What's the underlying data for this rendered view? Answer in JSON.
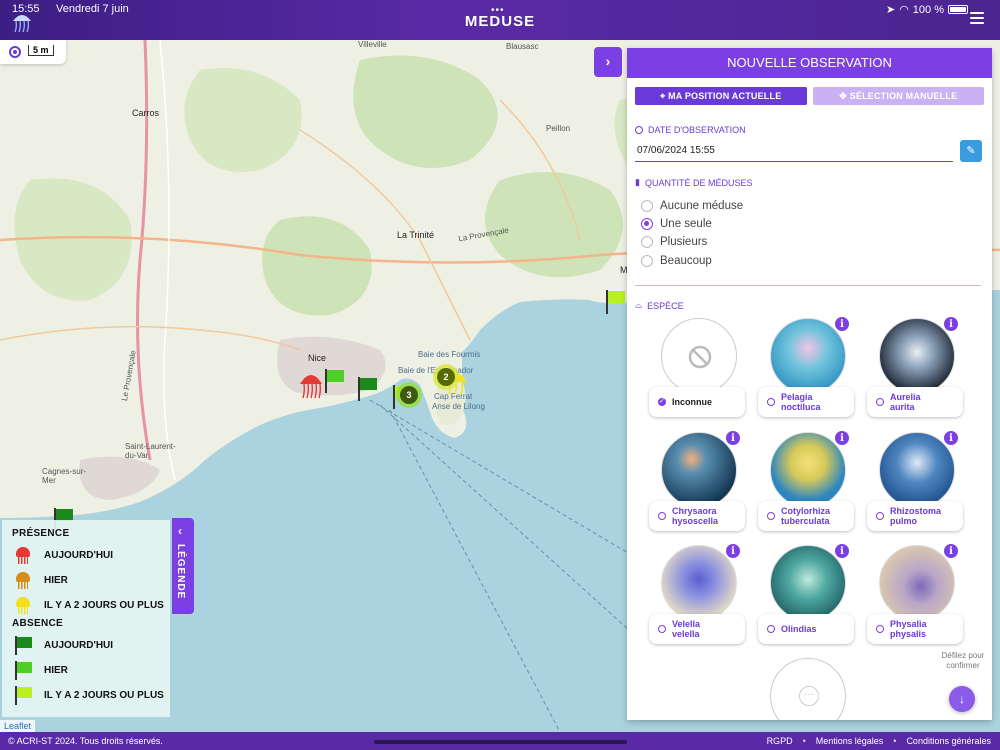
{
  "status_bar": {
    "time": "15:55",
    "date": "Vendredi 7 juin",
    "battery": "100 %"
  },
  "header": {
    "title": "MEDUSE",
    "dots": "•••"
  },
  "map": {
    "scale": "5 m",
    "attribution": "Leaflet",
    "labels": {
      "villeville": "Villeville",
      "carros": "Carros",
      "nice": "Nice",
      "la_trinite": "La Trinité",
      "la_provencale": "La Provençale",
      "saint_laurent": "Saint-Laurent-du-Var",
      "cagnes": "Cagnes-sur-Mer",
      "baie_fourmis": "Baie des Fourmis",
      "baie_espalmador": "Baie de l'Espalmador",
      "cap_ferrat": "Cap Ferrat",
      "anse_lilong": "Anse de Lilong",
      "blausasc": "Blausasc",
      "peillon": "Peillon",
      "le_provencale": "Le Provençale",
      "m": "M"
    },
    "clusters": {
      "c2": "2",
      "c3": "3"
    }
  },
  "legend": {
    "tab_label": "LÉGENDE",
    "presence_title": "PRÉSENCE",
    "absence_title": "ABSENCE",
    "presence": [
      {
        "label": "AUJOURD'HUI",
        "color": "#e53935"
      },
      {
        "label": "HIER",
        "color": "#d88a1a"
      },
      {
        "label": "IL Y A 2 JOURS OU PLUS",
        "color": "#f3e01a"
      }
    ],
    "absence": [
      {
        "label": "AUJOURD'HUI",
        "color": "#1a8a1a"
      },
      {
        "label": "HIER",
        "color": "#4fce2a"
      },
      {
        "label": "IL Y A 2 JOURS OU PLUS",
        "color": "#b8f020"
      }
    ]
  },
  "panel": {
    "title": "NOUVELLE OBSERVATION",
    "btn_position": "MA POSITION ACTUELLE",
    "btn_manual": "SÉLECTION MANUELLE",
    "date_label": "DATE D'OBSERVATION",
    "date_value": "07/06/2024 15:55",
    "quantity_label": "QUANTITÉ DE MÉDUSES",
    "quantity_options": [
      "Aucune méduse",
      "Une seule",
      "Plusieurs",
      "Beaucoup"
    ],
    "quantity_selected": "Une seule",
    "species_label": "ESPÈCE",
    "species": [
      {
        "l1": "Inconnue",
        "l2": "",
        "selected": true
      },
      {
        "l1": "Pelagia",
        "l2": "noctiluca",
        "selected": false
      },
      {
        "l1": "Aurelia",
        "l2": "aurita",
        "selected": false
      },
      {
        "l1": "Chrysaora",
        "l2": "hysoscella",
        "selected": false
      },
      {
        "l1": "Cotylorhiza",
        "l2": "tuberculata",
        "selected": false
      },
      {
        "l1": "Rhizostoma",
        "l2": "pulmo",
        "selected": false
      },
      {
        "l1": "Velella",
        "l2": "velella",
        "selected": false
      },
      {
        "l1": "Olindias",
        "l2": "",
        "selected": false
      },
      {
        "l1": "Physalia",
        "l2": "physalis",
        "selected": false
      }
    ],
    "info_glyph": "i",
    "more_glyph": "···",
    "scroll_hint": "Défilez pour confirmer"
  },
  "footer": {
    "copyright": "© ACRI-ST 2024. Tous droits réservés.",
    "links": [
      "RGPD",
      "Mentions légales",
      "Conditions générales"
    ],
    "separator": "•"
  },
  "colors": {
    "accent": "#7b3fe4",
    "accent_dark": "#6a3ad8",
    "accent_light": "#c9b1f3",
    "sea": "#aad3df",
    "land": "#eef0e4"
  }
}
